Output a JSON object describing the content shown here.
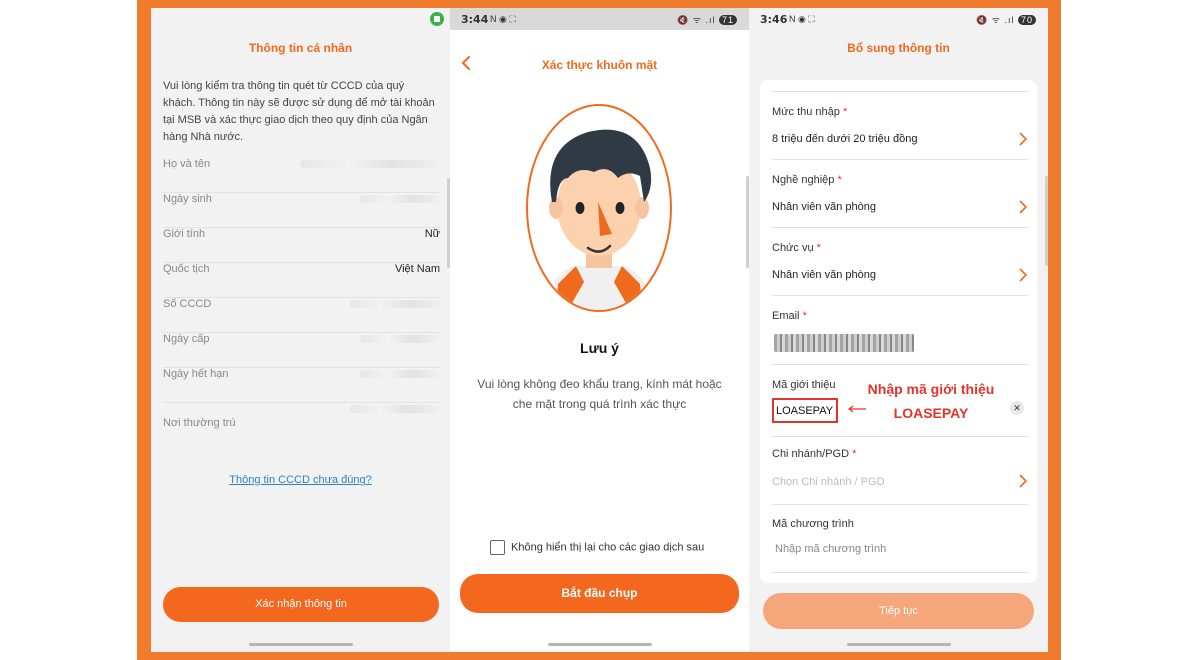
{
  "screen1": {
    "status_icons": "",
    "title": "Thông tin cá nhân",
    "intro": "Vui lòng kiểm tra thông tin quét từ CCCD của quý khách. Thông tin này sẽ được sử dụng để mở tài khoản tại MSB và xác thực  giao dịch theo quy định của Ngân hàng Nhà nước.",
    "rows": [
      {
        "label": "Họ và tên",
        "value": ""
      },
      {
        "label": "Ngày sinh",
        "value": ""
      },
      {
        "label": "Giới tính",
        "value": "Nữ"
      },
      {
        "label": "Quốc tịch",
        "value": "Việt Nam"
      },
      {
        "label": "Số CCCD",
        "value": ""
      },
      {
        "label": "Ngày cấp",
        "value": ""
      },
      {
        "label": "Ngày hết hạn",
        "value": ""
      },
      {
        "label": "Nơi thường trú",
        "value": ""
      }
    ],
    "link": "Thông tin CCCD chưa đúng?",
    "confirm_button": "Xác nhận thông tin"
  },
  "screen2": {
    "time": "3:44",
    "status_icons": "N ◉ ⛶",
    "status_right": "🔇 ᯤ .ıl",
    "battery": "71",
    "title": "Xác thực khuôn mặt",
    "note_title": "Lưu ý",
    "note_text": "Vui lòng không đeo khẩu trang, kính mát hoặc che mặt trong quá trình xác thực",
    "checkbox_label": "Không hiển thị lại cho các giao dịch sau",
    "start_button": "Bắt đầu chụp"
  },
  "screen3": {
    "time": "3:46",
    "status_icons": "N ◉ ⛶",
    "status_right": "🔇 ᯤ .ıl",
    "battery": "70",
    "title": "Bổ sung thông tin",
    "income_label": "Mức thu nhập",
    "income_value": "8 triệu đến dưới 20 triệu đồng",
    "job_label": "Nghề nghiệp",
    "job_value": "Nhân viên văn phòng",
    "position_label": "Chức vụ",
    "position_value": "Nhân viên văn phòng",
    "email_label": "Email",
    "referral_label": "Mã giới thiệu",
    "referral_value": "LOASEPAY",
    "branch_label": "Chi nhánh/PGD",
    "branch_placeholder": "Chọn Chi nhánh / PGD",
    "program_label": "Mã chương trình",
    "program_placeholder": "Nhập mã chương trình",
    "required_mark": "*",
    "continue_button": "Tiếp tục",
    "annotation_line1": "Nhập mã giới thiệu",
    "annotation_line2": "LOASEPAY"
  },
  "colors": {
    "frame": "#f07b2c",
    "accent": "#f4671f",
    "annotation": "#e2352b"
  }
}
